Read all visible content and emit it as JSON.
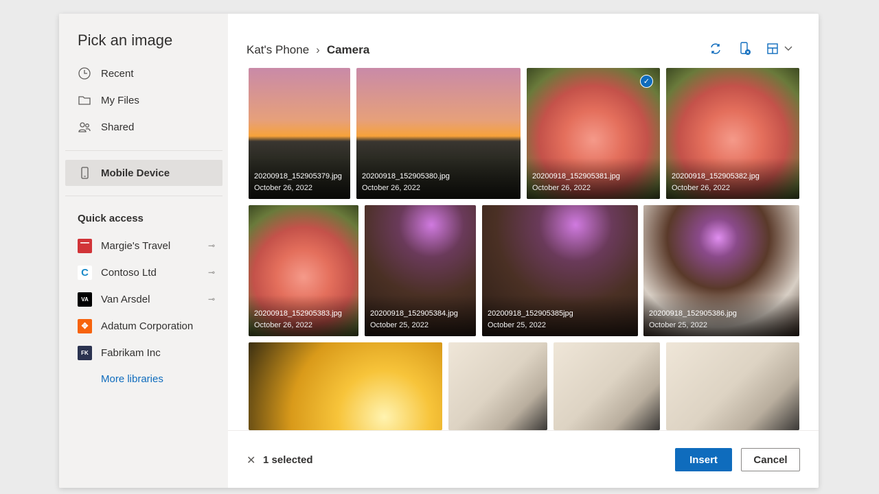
{
  "dialog": {
    "title": "Pick an image"
  },
  "nav": [
    {
      "label": "Recent",
      "icon": "clock-icon"
    },
    {
      "label": "My Files",
      "icon": "folder-icon"
    },
    {
      "label": "Shared",
      "icon": "people-icon"
    },
    {
      "label": "Mobile Device",
      "icon": "phone-icon",
      "selected": true
    }
  ],
  "quick_access": {
    "heading": "Quick access",
    "libraries": [
      {
        "label": "Margie's Travel",
        "badge": "",
        "color": "#d13438",
        "pinned": true
      },
      {
        "label": "Contoso Ltd",
        "badge": "C",
        "color": "#ffffff",
        "pinned": true
      },
      {
        "label": "Van Arsdel",
        "badge": "VA",
        "color": "#000000",
        "pinned": true
      },
      {
        "label": "Adatum Corporation",
        "badge": "",
        "color": "#f7630c",
        "pinned": false
      },
      {
        "label": "Fabrikam Inc",
        "badge": "FK",
        "color": "#2b3350",
        "pinned": false
      }
    ],
    "more": "More libraries"
  },
  "breadcrumb": {
    "root": "Kat's Phone",
    "current": "Camera"
  },
  "files": [
    {
      "name": "20200918_152905379.jpg",
      "date": "October 26, 2022"
    },
    {
      "name": "20200918_152905380.jpg",
      "date": "October 26, 2022"
    },
    {
      "name": "20200918_152905381.jpg",
      "date": "October 26, 2022",
      "selected": true
    },
    {
      "name": "20200918_152905382.jpg",
      "date": "October 26, 2022"
    },
    {
      "name": "20200918_152905383.jpg",
      "date": "October 26, 2022"
    },
    {
      "name": "20200918_152905384.jpg",
      "date": "October 25, 2022"
    },
    {
      "name": "20200918_152905385jpg",
      "date": "October 25, 2022"
    },
    {
      "name": "20200918_152905386.jpg",
      "date": "October 25, 2022"
    }
  ],
  "footer": {
    "selected": "1 selected",
    "insert": "Insert",
    "cancel": "Cancel"
  },
  "accent": "#0f6cbd"
}
